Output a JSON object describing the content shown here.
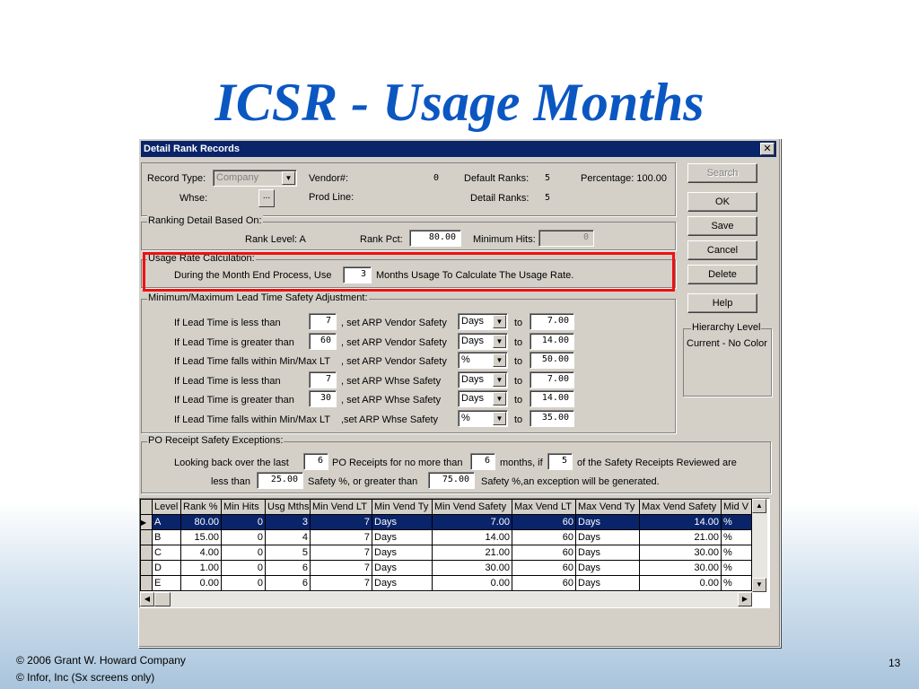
{
  "slide": {
    "title": "ICSR - Usage Months",
    "footer_line1": "©  2006 Grant W. Howard Company",
    "footer_line2": "©  Infor, Inc (Sx screens only)",
    "page_number": "13"
  },
  "dialog": {
    "title": "Detail Rank Records",
    "close": "✕",
    "header": {
      "record_type_label": "Record Type:",
      "record_type_value": "Company",
      "whse_label": "Whse:",
      "whse_button": "...",
      "vendor_label": "Vendor#:",
      "vendor_value": "0",
      "prod_line_label": "Prod Line:",
      "default_ranks_label": "Default Ranks:",
      "default_ranks_value": "5",
      "detail_ranks_label": "Detail Ranks:",
      "detail_ranks_value": "5",
      "percentage_label": "Percentage: 100.00"
    },
    "ranking": {
      "group_label": "Ranking Detail Based On:",
      "rank_level_label": "Rank Level:  A",
      "rank_pct_label": "Rank Pct:",
      "rank_pct_value": "80.00",
      "min_hits_label": "Minimum Hits:",
      "min_hits_value": "0"
    },
    "usage": {
      "group_label": "Usage Rate Calculation:",
      "prefix": "During the Month End Process, Use",
      "months_value": "3",
      "suffix": "Months Usage To Calculate The Usage Rate."
    },
    "lead_time": {
      "group_label": "Minimum/Maximum Lead Time Safety Adjustment:",
      "rows": [
        {
          "label": "If Lead Time is less than",
          "value": "7",
          "action": ", set ARP Vendor Safety",
          "unit": "Days",
          "to": "to",
          "result": "7.00"
        },
        {
          "label": "If Lead Time is greater than",
          "value": "60",
          "action": ", set ARP Vendor Safety",
          "unit": "Days",
          "to": "to",
          "result": "14.00"
        },
        {
          "label": "If Lead Time falls within Min/Max LT",
          "value": "",
          "action": ", set ARP Vendor Safety",
          "unit": "%",
          "to": "to",
          "result": "50.00"
        },
        {
          "label": "If Lead Time is less than",
          "value": "7",
          "action": ", set ARP Whse Safety",
          "unit": "Days",
          "to": "to",
          "result": "7.00"
        },
        {
          "label": "If Lead Time is greater than",
          "value": "30",
          "action": ", set ARP Whse Safety",
          "unit": "Days",
          "to": "to",
          "result": "14.00"
        },
        {
          "label": "If Lead Time falls within Min/Max LT",
          "value": "",
          "action": ",set ARP Whse Safety",
          "unit": "%",
          "to": "to",
          "result": "35.00"
        }
      ]
    },
    "po_receipt": {
      "group_label": "PO Receipt Safety Exceptions:",
      "t1": "Looking back over the last",
      "v1": "6",
      "t2": "PO Receipts for no more than",
      "v2": "6",
      "t3": "months, if",
      "v3": "5",
      "t4": "of the Safety Receipts Reviewed are",
      "t5": "less than",
      "v4": "25.00",
      "t6": "Safety %,  or greater than",
      "v5": "75.00",
      "t7": "Safety %,an exception will be generated."
    },
    "buttons": {
      "search": "Search",
      "ok": "OK",
      "save": "Save",
      "cancel": "Cancel",
      "delete": "Delete",
      "help": "Help"
    },
    "hierarchy": {
      "group_label": "Hierarchy Level",
      "value": "Current - No Color"
    },
    "grid": {
      "columns": [
        "Level",
        "Rank %",
        "Min Hits",
        "Usg Mths",
        "Min Vend LT",
        "Min Vend Ty",
        "Min Vend Safety",
        "Max Vend LT",
        "Max Vend Ty",
        "Max Vend Safety",
        "Mid V"
      ],
      "rows": [
        [
          "A",
          "80.00",
          "0",
          "3",
          "7",
          "Days",
          "7.00",
          "60",
          "Days",
          "14.00",
          "%"
        ],
        [
          "B",
          "15.00",
          "0",
          "4",
          "7",
          "Days",
          "14.00",
          "60",
          "Days",
          "21.00",
          "%"
        ],
        [
          "C",
          "4.00",
          "0",
          "5",
          "7",
          "Days",
          "21.00",
          "60",
          "Days",
          "30.00",
          "%"
        ],
        [
          "D",
          "1.00",
          "0",
          "6",
          "7",
          "Days",
          "30.00",
          "60",
          "Days",
          "30.00",
          "%"
        ],
        [
          "E",
          "0.00",
          "0",
          "6",
          "7",
          "Days",
          "0.00",
          "60",
          "Days",
          "0.00",
          "%"
        ]
      ]
    }
  }
}
